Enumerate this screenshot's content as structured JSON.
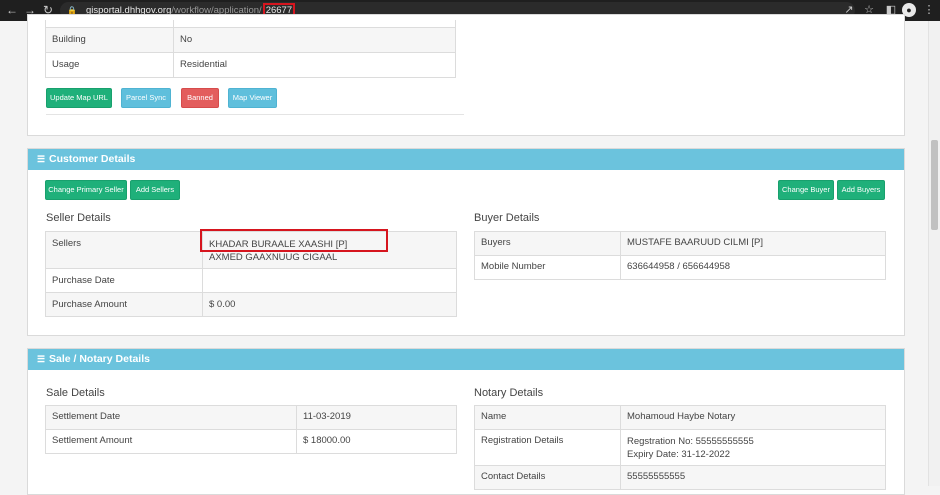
{
  "browser": {
    "url_host": "gisportal.dhhgov.org",
    "url_path": "/workflow/application/",
    "url_id": "26677"
  },
  "top_panel": {
    "rows": [
      {
        "label": "Building",
        "value": "No"
      },
      {
        "label": "Usage",
        "value": "Residential"
      }
    ],
    "buttons": {
      "update_map": "Update Map URL",
      "parcel_sync": "Parcel Sync",
      "banned": "Banned",
      "map_viewer": "Map Viewer"
    }
  },
  "customer": {
    "heading": "Customer Details",
    "buttons": {
      "change_primary_seller": "Change Primary Seller",
      "add_sellers": "Add Sellers",
      "change_buyer": "Change Buyer",
      "add_buyers": "Add Buyers"
    },
    "seller_title": "Seller Details",
    "seller": {
      "sellers_label": "Sellers",
      "seller_1": "KHADAR BURAALE XAASHI [P]",
      "seller_2": "AXMED GAAXNUUG CIGAAL",
      "purchase_date_label": "Purchase Date",
      "purchase_date_value": "",
      "purchase_amount_label": "Purchase Amount",
      "purchase_amount_value": "$ 0.00"
    },
    "buyer_title": "Buyer Details",
    "buyer": {
      "buyers_label": "Buyers",
      "buyers_value": "MUSTAFE BAARUUD CILMI [P]",
      "mobile_label": "Mobile Number",
      "mobile_value": "636644958 / 656644958"
    }
  },
  "sale": {
    "heading": "Sale / Notary Details",
    "sale_title": "Sale Details",
    "settlement_date_label": "Settlement Date",
    "settlement_date_value": "11-03-2019",
    "settlement_amount_label": "Settlement Amount",
    "settlement_amount_value": "$ 18000.00",
    "notary_title": "Notary Details",
    "name_label": "Name",
    "name_value": "Mohamoud Haybe Notary",
    "registration_label": "Registration Details",
    "registration_no": "Regstration No: 55555555555",
    "expiry_date": "Expiry Date: 31-12-2022",
    "contact_label": "Contact Details",
    "contact_value": "55555555555"
  },
  "colors": {
    "panel_heading": "#6bc3dd",
    "green_button": "#1fb07a",
    "blue_button": "#5fbfdc",
    "red_button": "#e35d5d",
    "highlight_box": "#d6151e"
  }
}
